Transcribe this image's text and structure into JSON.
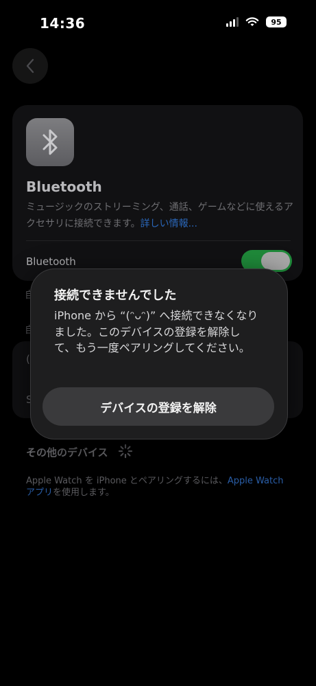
{
  "status_bar": {
    "time": "14:36",
    "battery": "95"
  },
  "bluetooth_card": {
    "title": "Bluetooth",
    "description": "ミュージックのストリーミング、通話、ゲームなどに使えるアクセサリに接続できます。",
    "link": "詳しい情報...",
    "toggle_label": "Bluetooth",
    "toggle_on": true
  },
  "sections": {
    "my_devices_first_char": "自",
    "other_label_first_char": "自"
  },
  "devices": [
    {
      "name_partial": "(",
      "info_partial": "i"
    },
    {
      "name_partial": "S",
      "info_partial": "i"
    }
  ],
  "other_devices": {
    "title": "その他のデバイス"
  },
  "footer": {
    "text_prefix": "Apple Watch を iPhone とペアリングするには、",
    "link": "Apple Watch アプリ",
    "text_suffix": "を使用します。"
  },
  "modal": {
    "title": "接続できませんでした",
    "body": "iPhone から “(ᵔᴗᵔ)” へ接続できなくなりました。このデバイスの登録を解除して、もう一度ペアリングしてください。",
    "button": "デバイスの登録を解除"
  },
  "colors": {
    "accent_link": "#2a66b8",
    "toggle_green": "#1f8a3a",
    "modal_bg": "#1e1e1f"
  }
}
